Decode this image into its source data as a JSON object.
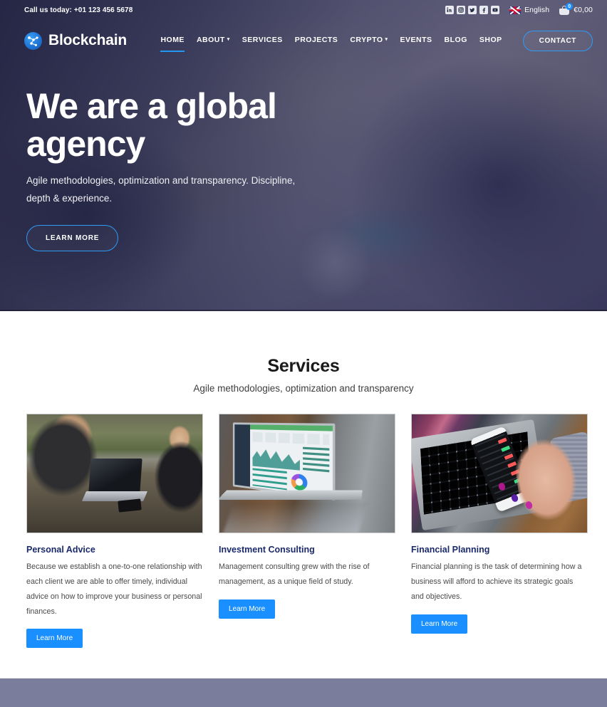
{
  "topbar": {
    "phone_text": "Call us today: +01 123 456 5678",
    "social": [
      {
        "name": "linkedin-icon",
        "glyph": "in"
      },
      {
        "name": "instagram-icon",
        "glyph": "▣"
      },
      {
        "name": "twitter-icon",
        "glyph": "✓"
      },
      {
        "name": "facebook-icon",
        "glyph": "f"
      },
      {
        "name": "youtube-icon",
        "glyph": "▶"
      }
    ],
    "language": "English",
    "cart_badge": "0",
    "cart_total": "€0,00"
  },
  "brand": {
    "name": "Blockchain",
    "logo_icon": "blockchain-network-icon"
  },
  "nav": {
    "items": [
      {
        "label": "HOME",
        "has_dropdown": false,
        "active": true
      },
      {
        "label": "ABOUT",
        "has_dropdown": true,
        "active": false
      },
      {
        "label": "SERVICES",
        "has_dropdown": false,
        "active": false
      },
      {
        "label": "PROJECTS",
        "has_dropdown": false,
        "active": false
      },
      {
        "label": "CRYPTO",
        "has_dropdown": true,
        "active": false
      },
      {
        "label": "EVENTS",
        "has_dropdown": false,
        "active": false
      },
      {
        "label": "BLOG",
        "has_dropdown": false,
        "active": false
      },
      {
        "label": "SHOP",
        "has_dropdown": false,
        "active": false
      }
    ],
    "contact_label": "CONTACT"
  },
  "hero": {
    "title": "We are a global agency",
    "subtitle": "Agile methodologies, optimization and transparency. Discipline, depth & experience.",
    "cta_label": "LEARN MORE"
  },
  "services": {
    "title": "Services",
    "subtitle": "Agile methodologies, optimization and transparency",
    "cards": [
      {
        "image_alt": "two-business-people-with-laptop-at-outdoor-table",
        "title": "Personal Advice",
        "text": "Because we establish a one-to-one relationship with each client we are able to offer timely, individual advice on how to improve your business or personal finances.",
        "button_label": "Learn More"
      },
      {
        "image_alt": "laptop-showing-analytics-dashboard-on-glossy-table",
        "title": "Investment Consulting",
        "text": "Management consulting grew with the rise of management, as a unique field of study.",
        "button_label": "Learn More"
      },
      {
        "image_alt": "hands-holding-smartphone-with-trading-app-over-laptop",
        "title": "Financial Planning",
        "text": "Financial planning is the task of determining how a business will afford to achieve its strategic goals and objectives.",
        "button_label": "Learn More"
      }
    ]
  },
  "colors": {
    "accent_blue": "#1a8fff",
    "nav_active_underline": "#2196f3",
    "hero_overlay_navy": "#23254a",
    "card_title_navy": "#1b2a6b",
    "bottom_band": "#7b7d9c"
  }
}
